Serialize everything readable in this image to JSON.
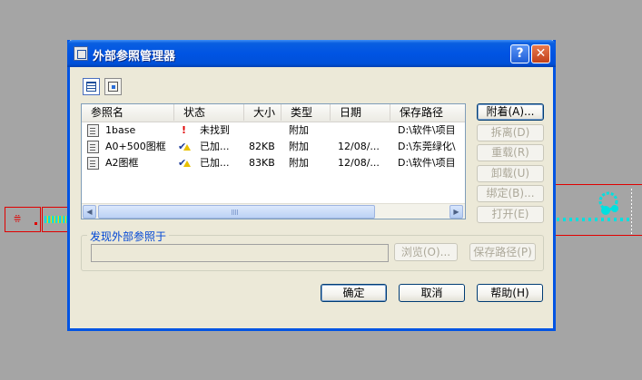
{
  "dialog": {
    "title": "外部参照管理器",
    "help_glyph": "?",
    "close_glyph": "✕"
  },
  "list": {
    "columns": [
      "参照名",
      "状态",
      "大小",
      "类型",
      "日期",
      "保存路径"
    ],
    "rows": [
      {
        "name": "1base",
        "status": "未找到",
        "status_icon": "exclamation-icon",
        "size": "",
        "type": "附加",
        "date": "",
        "path": "D:\\软件\\项目"
      },
      {
        "name": "A0+500图框",
        "status": "已加...",
        "status_icon": "loaded-warning-icon",
        "size": "82KB",
        "type": "附加",
        "date": "12/08/...",
        "path": "D:\\东莞绿化\\"
      },
      {
        "name": "A2图框",
        "status": "已加...",
        "status_icon": "loaded-warning-icon",
        "size": "83KB",
        "type": "附加",
        "date": "12/08/...",
        "path": "D:\\软件\\项目"
      }
    ],
    "scroll": {
      "left_arrow": "◀",
      "right_arrow": "▶"
    }
  },
  "side_buttons": {
    "attach": "附着(A)...",
    "detach": "拆离(D)",
    "reload": "重载(R)",
    "unload": "卸载(U)",
    "bind": "绑定(B)...",
    "open": "打开(E)"
  },
  "found_at": {
    "label": "发现外部参照于",
    "path_value": "",
    "browse": "浏览(O)...",
    "save_path": "保存路径(P)"
  },
  "bottom_buttons": {
    "ok": "确定",
    "cancel": "取消",
    "help": "帮助(H)"
  },
  "colors": {
    "titlebar": "#0054e3",
    "dialog_bg": "#ece9d8",
    "cad_background": "#a5a5a5",
    "cad_red": "#e00000",
    "cad_cyan": "#00e0e0"
  }
}
